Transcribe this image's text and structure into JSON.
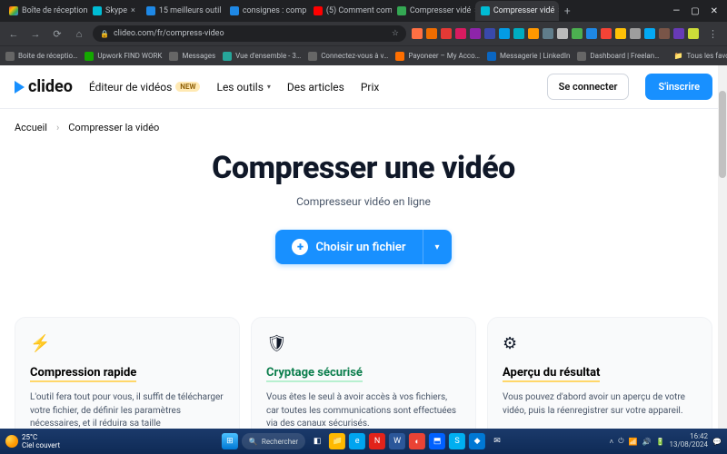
{
  "browser": {
    "tabs": [
      {
        "icon": "gm",
        "title": "Boîte de réception"
      },
      {
        "icon": "cyan",
        "title": "Skype"
      },
      {
        "icon": "blue",
        "title": "15 meilleurs outil"
      },
      {
        "icon": "blue",
        "title": "consignes : comp"
      },
      {
        "icon": "red",
        "title": "(5) Comment com"
      },
      {
        "icon": "green",
        "title": "Compresser vidé"
      },
      {
        "icon": "cyan",
        "title": "Compresser vidé",
        "active": true
      }
    ],
    "url": "clideo.com/fr/compress-video",
    "bookmarks": [
      "Boite de réceptio…",
      "Upwork FIND WORK",
      "Messages",
      "Vue d'ensemble - 3…",
      "Connectez-vous à v…",
      "Payoneer – My Acco…",
      "Messagerie | LinkedIn",
      "Dashboard | Freelan…"
    ],
    "all_bookmarks": "Tous les favoris"
  },
  "header": {
    "brand": "clideo",
    "editor": "Éditeur de vidéos",
    "new": "NEW",
    "tools": "Les outils",
    "articles": "Des articles",
    "price": "Prix",
    "login": "Se connecter",
    "signup": "S'inscrire"
  },
  "crumbs": {
    "home": "Accueil",
    "sep": "›",
    "current": "Compresser la vidéo"
  },
  "hero": {
    "title": "Compresser une vidéo",
    "subtitle": "Compresseur vidéo en ligne",
    "button": "Choisir un fichier"
  },
  "features": [
    {
      "icon": "⚡",
      "title": "Compression rapide",
      "body": "L'outil fera tout pour vous, il suffit de télécharger votre fichier, de définir les paramètres nécessaires, et il réduira sa taille"
    },
    {
      "icon": "🛡",
      "title": "Cryptage sécurisé",
      "body": "Vous êtes le seul à avoir accès à vos fichiers, car toutes les communications sont effectuées via des canaux sécurisés."
    },
    {
      "icon": "⚙",
      "title": "Aperçu du résultat",
      "body": "Vous pouvez d'abord avoir un aperçu de votre vidéo, puis la réenregistrer sur votre appareil."
    }
  ],
  "taskbar": {
    "temp": "25°C",
    "cond": "Ciel couvert",
    "search": "Rechercher",
    "time": "16:42",
    "date": "13/08/2024"
  },
  "colors": {
    "accent": "#1890ff"
  }
}
